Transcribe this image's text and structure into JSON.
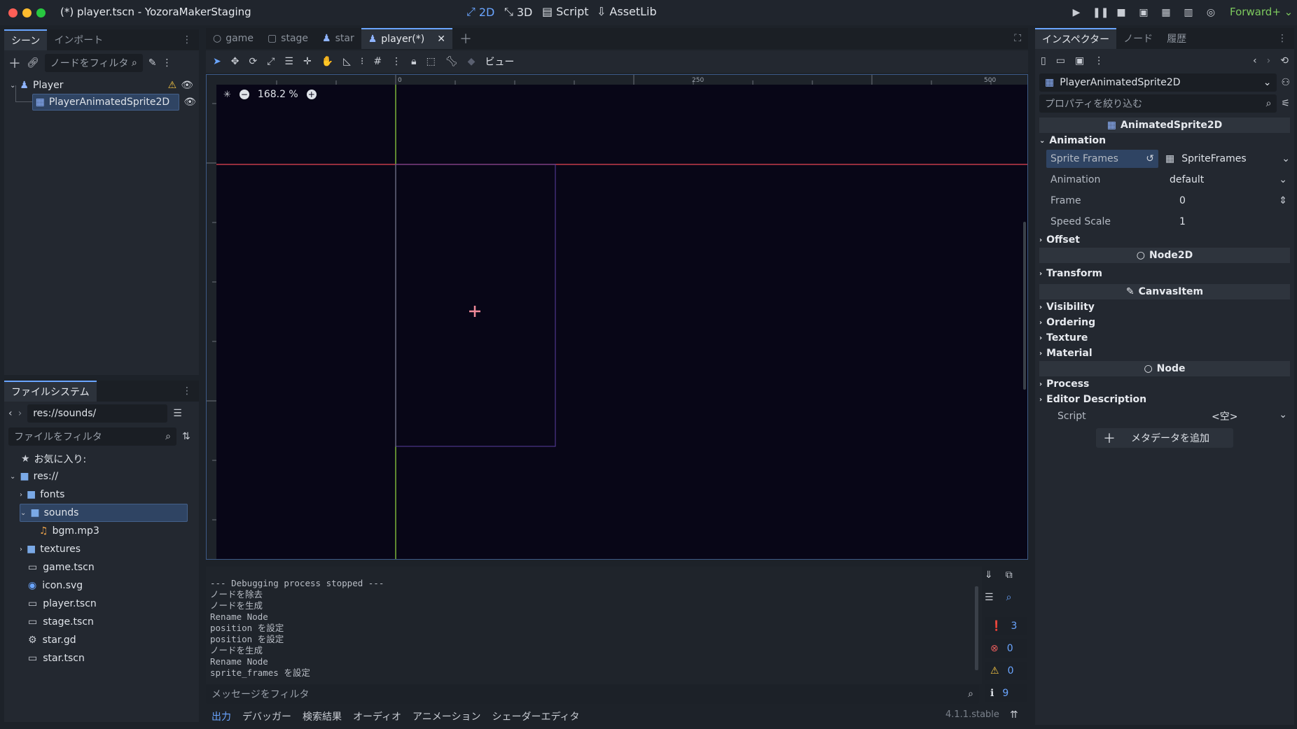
{
  "window": {
    "title": "(*) player.tscn - YozoraMakerStaging",
    "modes": [
      {
        "label": "2D",
        "icon": "2d-icon",
        "active": true
      },
      {
        "label": "3D",
        "icon": "3d-icon",
        "active": false
      },
      {
        "label": "Script",
        "icon": "script-icon",
        "active": false
      },
      {
        "label": "AssetLib",
        "icon": "assetlib-icon",
        "active": false
      }
    ],
    "renderer": "Forward+"
  },
  "scene_panel": {
    "tabs": [
      "シーン",
      "インポート"
    ],
    "filter_placeholder": "ノードをフィルタ",
    "nodes": [
      {
        "label": "Player",
        "icon": "character-icon"
      },
      {
        "label": "PlayerAnimatedSprite2D",
        "icon": "animated-sprite-icon"
      }
    ]
  },
  "filesystem": {
    "tab": "ファイルシステム",
    "path": "res://sounds/",
    "filter_placeholder": "ファイルをフィルタ",
    "favorites": "お気に入り:",
    "root": "res://",
    "items": [
      {
        "label": "fonts",
        "type": "folder"
      },
      {
        "label": "sounds",
        "type": "folder"
      },
      {
        "label": "bgm.mp3",
        "type": "audio"
      },
      {
        "label": "textures",
        "type": "folder"
      },
      {
        "label": "game.tscn",
        "type": "scene"
      },
      {
        "label": "icon.svg",
        "type": "image"
      },
      {
        "label": "player.tscn",
        "type": "scene"
      },
      {
        "label": "stage.tscn",
        "type": "scene"
      },
      {
        "label": "star.gd",
        "type": "script"
      },
      {
        "label": "star.tscn",
        "type": "scene"
      }
    ]
  },
  "editor_tabs": [
    {
      "label": "game",
      "icon": "circle-node-icon"
    },
    {
      "label": "stage",
      "icon": "control-node-icon"
    },
    {
      "label": "star",
      "icon": "character-icon"
    },
    {
      "label": "player(*)",
      "icon": "character-icon",
      "active": true
    }
  ],
  "toolbar": {
    "view_label": "ビュー"
  },
  "viewport": {
    "zoom": "168.2 %",
    "ruler_marks": [
      "0",
      "250",
      "500"
    ],
    "colors": {
      "x_axis": "#c23a4a",
      "y_axis": "#7bb33a",
      "canvas": "#080617",
      "frame": "#5a3fa0"
    }
  },
  "output": {
    "lines": [
      "--- Debugging process stopped ---",
      "ノードを除去",
      "ノードを生成",
      "Rename Node",
      "position を設定",
      "position を設定",
      "ノードを生成",
      "Rename Node",
      "sprite_frames を設定"
    ],
    "filter_placeholder": "メッセージをフィルタ",
    "counts": {
      "messages": "3",
      "errors": "0",
      "warnings": "0",
      "info": "9"
    }
  },
  "bottom_tabs": [
    "出力",
    "デバッガー",
    "検索結果",
    "オーディオ",
    "アニメーション",
    "シェーダーエディタ"
  ],
  "version": "4.1.1.stable",
  "inspector": {
    "tabs": [
      "インスペクター",
      "ノード",
      "履歴"
    ],
    "object_name": "PlayerAnimatedSprite2D",
    "filter_placeholder": "プロパティを絞り込む",
    "class_header": "AnimatedSprite2D",
    "animation_group": "Animation",
    "properties": {
      "sprite_frames_label": "Sprite Frames",
      "sprite_frames_value": "SpriteFrames",
      "animation_label": "Animation",
      "animation_value": "default",
      "frame_label": "Frame",
      "frame_value": "0",
      "speed_label": "Speed Scale",
      "speed_value": "1"
    },
    "offset_group": "Offset",
    "node2d_header": "Node2D",
    "transform_group": "Transform",
    "canvasitem_header": "CanvasItem",
    "canvas_groups": [
      "Visibility",
      "Ordering",
      "Texture",
      "Material"
    ],
    "node_header": "Node",
    "node_groups": [
      "Process",
      "Editor Description"
    ],
    "script_label": "Script",
    "script_value": "<空>",
    "add_metadata": "メタデータを追加"
  }
}
